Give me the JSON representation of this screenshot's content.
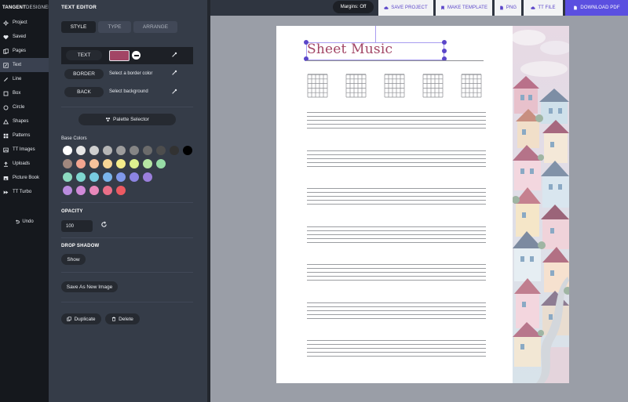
{
  "app": {
    "brand_bold": "TANGENT",
    "brand_light": "DESIGNER"
  },
  "sidebar": {
    "items": [
      {
        "label": "Project",
        "icon": "gear-icon"
      },
      {
        "label": "Saved",
        "icon": "heart-icon"
      },
      {
        "label": "Pages",
        "icon": "pages-icon"
      },
      {
        "label": "Text",
        "icon": "text-edit-icon",
        "active": true
      },
      {
        "label": "Line",
        "icon": "line-icon"
      },
      {
        "label": "Box",
        "icon": "box-icon"
      },
      {
        "label": "Circle",
        "icon": "circle-icon"
      },
      {
        "label": "Shapes",
        "icon": "triangle-icon"
      },
      {
        "label": "Patterns",
        "icon": "grid-icon"
      },
      {
        "label": "TT Images",
        "icon": "image-icon"
      },
      {
        "label": "Uploads",
        "icon": "upload-icon"
      },
      {
        "label": "Picture Book",
        "icon": "picture-icon"
      },
      {
        "label": "TT Turbo",
        "icon": "turbo-icon"
      }
    ],
    "undo_label": "Undo"
  },
  "editor": {
    "title": "TEXT EDITOR",
    "tabs": [
      {
        "label": "STYLE",
        "active": true
      },
      {
        "label": "TYPE",
        "active": false
      },
      {
        "label": "ARRANGE",
        "active": false
      }
    ],
    "text_row": {
      "label": "TEXT",
      "color": "#a24565"
    },
    "border_row": {
      "label": "BORDER",
      "placeholder": "Select a border color"
    },
    "back_row": {
      "label": "BACK",
      "placeholder": "Select background"
    },
    "palette_button": "Palette Selector",
    "base_colors_title": "Base Colors",
    "base_colors": [
      "#ffffff",
      "#e6e6e6",
      "#cfcfcf",
      "#b5b5b5",
      "#9d9d9d",
      "#858585",
      "#6b6b6b",
      "#4d4d4d",
      "#323232",
      "#000000",
      "#a0877e",
      "#f2a590",
      "#f6c29b",
      "#f6d595",
      "#f4ec8a",
      "#dcef8e",
      "#b6e6a3",
      "#97dca6",
      "#8ddac0",
      "#7fd6d0",
      "#78cbe0",
      "#7ab5ec",
      "#7f98ea",
      "#8c84e2",
      "#9b7fdc",
      "#b98cde",
      "#d08ad8",
      "#e889bb",
      "#ea6f88",
      "#ec5a62"
    ],
    "opacity": {
      "title": "OPACITY",
      "value": "100"
    },
    "drop_shadow": {
      "title": "DROP SHADOW",
      "button": "Show"
    },
    "save_image_button": "Save As New Image",
    "duplicate_button": "Duplicate",
    "delete_button": "Delete"
  },
  "topbar": {
    "margins_label": "Margins: Off",
    "buttons": [
      {
        "label": "SAVE PROJECT",
        "icon": "cloud-upload-icon"
      },
      {
        "label": "MAKE TEMPLATE",
        "icon": "bookmark-icon"
      },
      {
        "label": "PNG",
        "icon": "file-icon"
      },
      {
        "label": "TT FILE",
        "icon": "cloud-icon"
      },
      {
        "label": "DOWNLOAD PDF",
        "icon": "document-icon"
      }
    ]
  },
  "page": {
    "title_text": "Sheet Music",
    "chord_diagrams": 5,
    "staves": 7,
    "lines_per_staff": 5
  }
}
